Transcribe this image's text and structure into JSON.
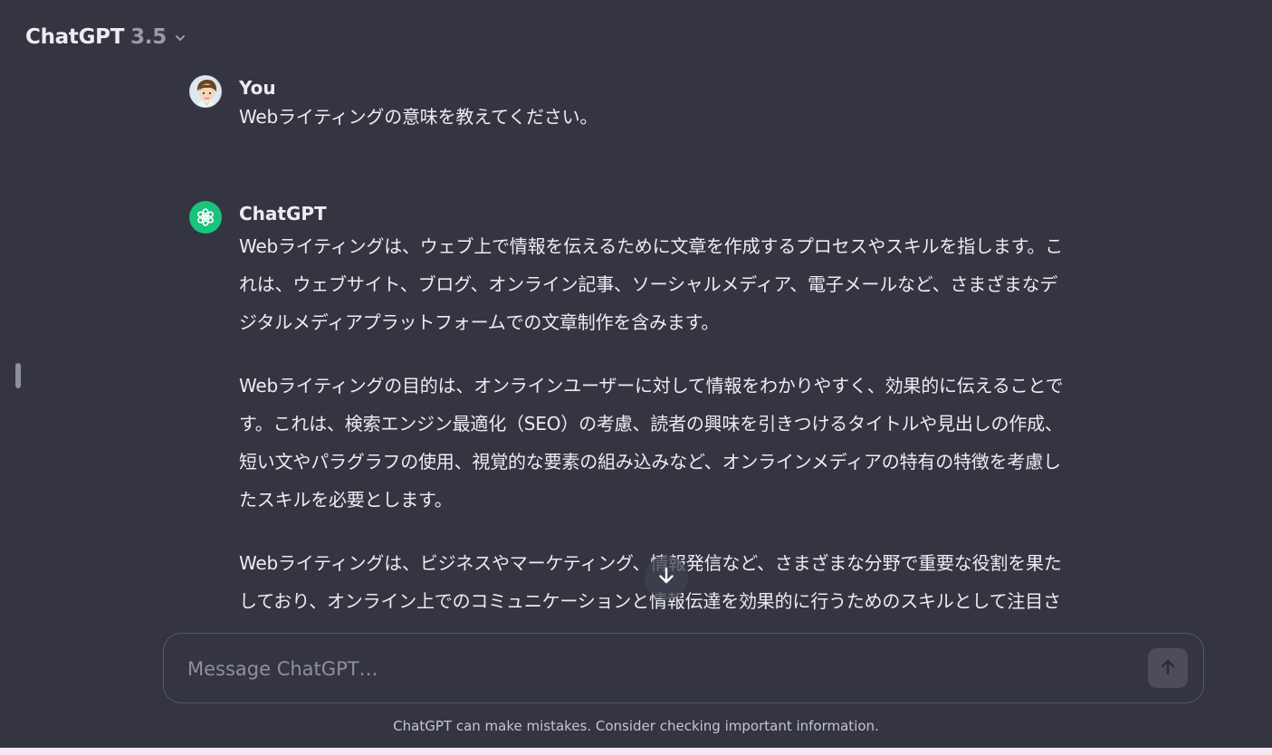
{
  "header": {
    "model_name": "ChatGPT",
    "model_version": "3.5"
  },
  "messages": [
    {
      "author": "You",
      "paragraphs": [
        "Webライティングの意味を教えてください。"
      ]
    },
    {
      "author": "ChatGPT",
      "paragraphs": [
        "Webライティングは、ウェブ上で情報を伝えるために文章を作成するプロセスやスキルを指します。これは、ウェブサイト、ブログ、オンライン記事、ソーシャルメディア、電子メールなど、さまざまなデジタルメディアプラットフォームでの文章制作を含みます。",
        "Webライティングの目的は、オンラインユーザーに対して情報をわかりやすく、効果的に伝えることです。これは、検索エンジン最適化（SEO）の考慮、読者の興味を引きつけるタイトルや見出しの作成、短い文やパラグラフの使用、視覚的な要素の組み込みなど、オンラインメディアの特有の特徴を考慮したスキルを必要とします。",
        "Webライティングは、ビジネスやマーケティング、情報発信など、さまざまな分野で重要な役割を果たしており、オンライン上でのコミュニケーションと情報伝達を効果的に行うためのスキルとして注目されて"
      ]
    }
  ],
  "composer": {
    "placeholder": "Message ChatGPT…",
    "value": ""
  },
  "footer": {
    "disclaimer": "ChatGPT can make mistakes. Consider checking important information."
  },
  "colors": {
    "background": "#343541",
    "accent": "#19c37d",
    "text": "#ececf1",
    "muted": "#8e8ea0"
  },
  "icons": {
    "model_dropdown": "chevron-down-icon",
    "user_avatar": "user-avatar-icon",
    "assistant_avatar": "openai-logo-icon",
    "scroll": "arrow-down-icon",
    "send": "arrow-up-icon"
  }
}
